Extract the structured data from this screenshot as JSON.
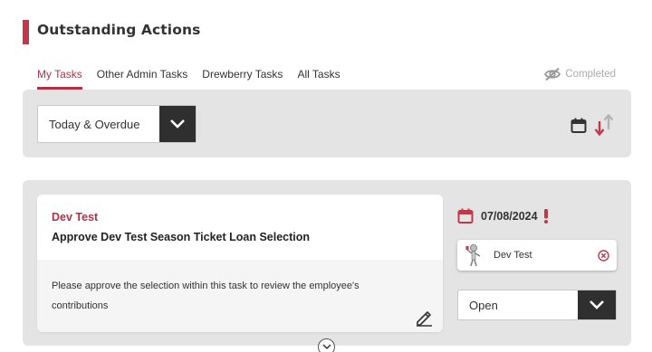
{
  "header": {
    "title": "Outstanding Actions"
  },
  "tabs": [
    {
      "label": "My Tasks",
      "active": true
    },
    {
      "label": "Other Admin Tasks",
      "active": false
    },
    {
      "label": "Drewberry Tasks",
      "active": false
    },
    {
      "label": "All Tasks",
      "active": false
    }
  ],
  "completed_toggle": {
    "label": "Completed",
    "icon": "eye-slash-icon"
  },
  "filter": {
    "selected": "Today & Overdue",
    "sort_icons": [
      "calendar-icon",
      "sort-arrows-icon"
    ]
  },
  "task": {
    "owner": "Dev Test",
    "title": "Approve Dev Test Season Ticket Loan Selection",
    "description": "Please approve the selection within this task to review the employee's contributions",
    "due_date": "07/08/2024",
    "overdue_icon": "exclamation-icon",
    "assignee": "Dev Test",
    "status": "Open"
  },
  "colors": {
    "accent": "#b23244",
    "panel": "#e4e4e4",
    "dark": "#2f2f2f"
  }
}
